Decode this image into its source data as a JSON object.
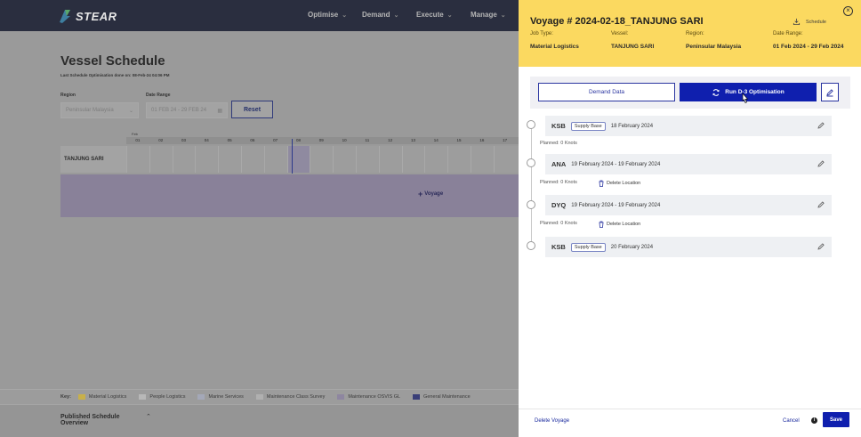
{
  "app": {
    "logo_text": "STEAR",
    "nav": [
      {
        "label": "Optimise"
      },
      {
        "label": "Demand"
      },
      {
        "label": "Execute"
      },
      {
        "label": "Manage"
      }
    ]
  },
  "schedule": {
    "title": "Vessel Schedule",
    "last_optimisation": "Last Schedule Optimisation done on: 08-Feb-24 04:06 PM",
    "region_label": "Region",
    "region_value": "Peninsular Malaysia",
    "date_label": "Date Range",
    "date_value": "01 FEB 24 - 29 FEB 24",
    "reset_label": "Reset",
    "month_label": "Feb",
    "days": [
      "01",
      "02",
      "03",
      "04",
      "05",
      "06",
      "07",
      "08",
      "09",
      "10",
      "11",
      "12",
      "13",
      "14",
      "15",
      "16",
      "17"
    ],
    "vessel_row": "TANJUNG SARI",
    "add_voyage_label": "Voyage"
  },
  "legend": {
    "key_label": "Key:",
    "items": [
      {
        "label": "Material Logistics",
        "color": "#c8b04a"
      },
      {
        "label": "People Logistics",
        "color": "#b8b8b8"
      },
      {
        "label": "Marine Services",
        "color": "#a4a8b8"
      },
      {
        "label": "Maintenance Class Survey",
        "color": "#b0b0b0"
      },
      {
        "label": "Maintenance OSVIS GL",
        "color": "#8e86a0"
      },
      {
        "label": "General Maintenance",
        "color": "#3a3f78"
      }
    ]
  },
  "published": {
    "title_line1": "Published Schedule",
    "title_line2": "Overview"
  },
  "drawer": {
    "title": "Voyage # 2024-02-18_TANJUNG SARI",
    "schedule_link": "Schedule",
    "meta": [
      {
        "label": "Job Type:",
        "value": "Material Logistics"
      },
      {
        "label": "Vessel:",
        "value": "TANJUNG SARI"
      },
      {
        "label": "Region:",
        "value": "Peninsular Malaysia"
      },
      {
        "label": "Date Range:",
        "value": "01 Feb 2024 - 29 Feb 2024"
      }
    ],
    "demand_data_label": "Demand Data",
    "run_optimisation_label": "Run D-3 Optimisation",
    "stops": [
      {
        "code": "KSB",
        "tag": "Supply Base",
        "date": "18 February 2024",
        "planned": "Planned: 0 Knots"
      },
      {
        "code": "ANA",
        "date": "19 February 2024 - 19 February 2024",
        "planned": "Planned: 0 Knots",
        "delete": "Delete Location"
      },
      {
        "code": "DYQ",
        "date": "19 February 2024 - 19 February 2024",
        "planned": "Planned: 0 Knots",
        "delete": "Delete Location"
      },
      {
        "code": "KSB",
        "tag": "Supply Base",
        "date": "20 February 2024"
      }
    ],
    "delete_voyage_label": "Delete Voyage",
    "cancel_label": "Cancel",
    "save_label": "Save",
    "accent_color": "#fbd960",
    "primary_color": "#0f1fae"
  }
}
